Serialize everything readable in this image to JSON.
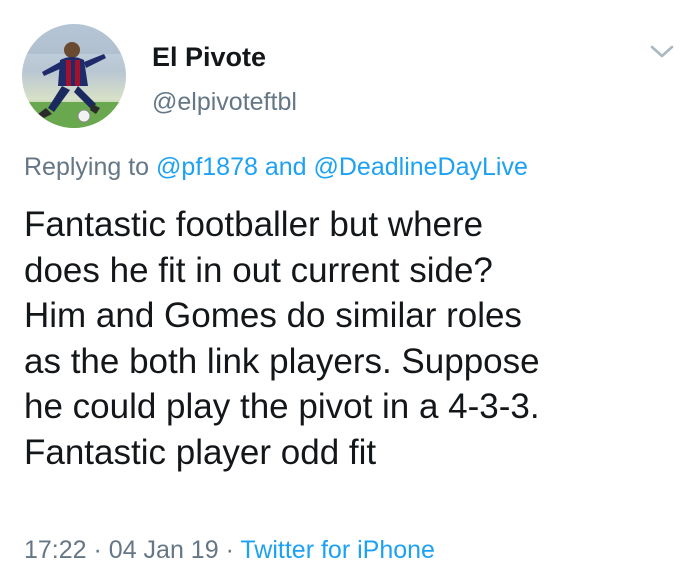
{
  "user": {
    "display_name": "El Pivote",
    "handle": "@elpivoteftbl"
  },
  "reply": {
    "prefix": "Replying to",
    "mention_1": "@pf1878",
    "conjunction": "and",
    "mention_2": "@DeadlineDayLive"
  },
  "tweet": {
    "lines": [
      "Fantastic footballer but where",
      "does he fit in out current side?",
      "Him and Gomes do similar roles",
      "as the both link players. Suppose",
      "he could play the pivot in a 4-3-3.",
      "Fantastic player odd fit"
    ]
  },
  "meta": {
    "time": "17:22",
    "separator": "·",
    "date": "04 Jan 19",
    "source": "Twitter for iPhone"
  },
  "icons": {
    "menu": "chevron-down-icon"
  },
  "colors": {
    "link": "#1da1f2",
    "secondary_text": "#657786",
    "primary_text": "#14171a"
  }
}
